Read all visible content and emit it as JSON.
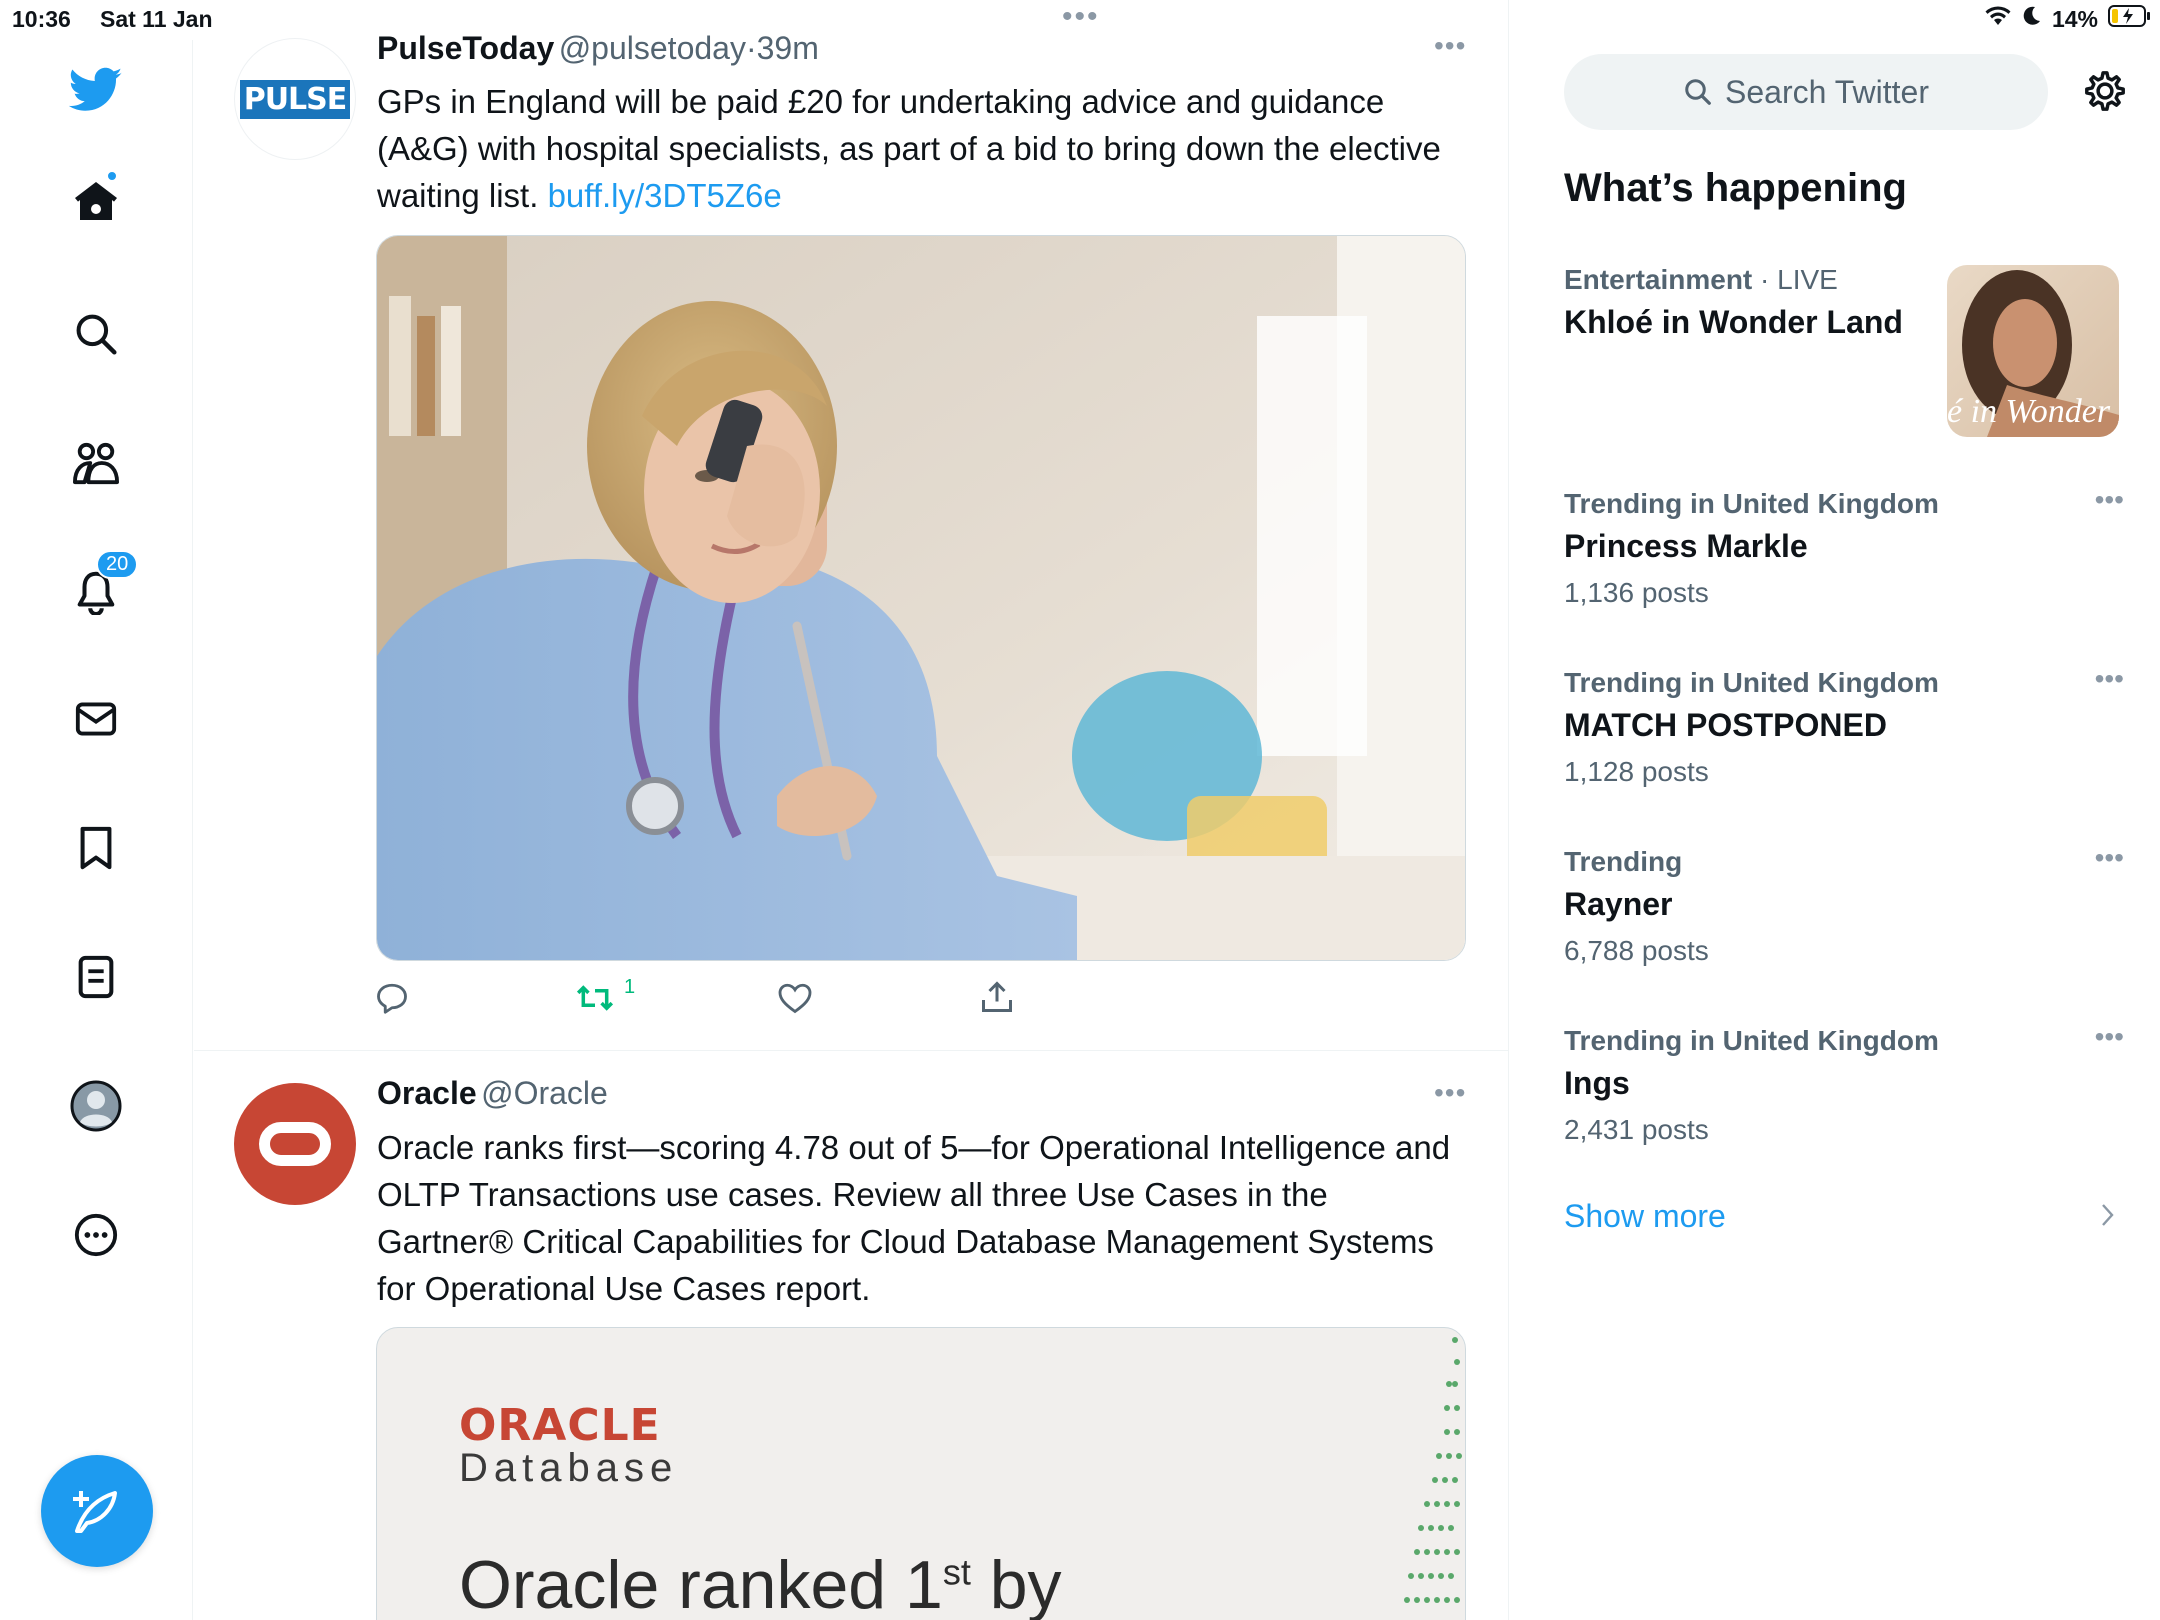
{
  "status_bar": {
    "time": "10:36",
    "date": "Sat 11 Jan",
    "battery": "14%",
    "center_dots": "•••"
  },
  "nav": {
    "notifications_badge": "20"
  },
  "tweets": [
    {
      "name": "PulseToday",
      "handle": "@pulsetoday",
      "sep": "·",
      "time": "39m",
      "avatar_text": "PULSE",
      "text": "GPs in England will be paid £20 for undertaking advice and guidance (A&G) with hospital specialists, as part of a bid to bring down the elective waiting list.",
      "link": "buff.ly/3DT5Z6e",
      "retweets": "1"
    },
    {
      "name": "Oracle",
      "handle": "@Oracle",
      "text": "Oracle ranks first—scoring 4.78 out of 5—for Operational Intelligence and OLTP Transactions use cases. Review all three Use Cases in the Gartner® Critical Capabilities for Cloud Database Management Systems for Operational Use Cases report.",
      "card_brand": "ORACLE",
      "card_product": "Database",
      "card_headline": "Oracle ranked 1",
      "card_sup": "st",
      "card_headline_end": " by"
    }
  ],
  "sidebar": {
    "search_placeholder": "Search Twitter",
    "title": "What’s happening",
    "featured": {
      "category": "Entertainment",
      "sep": " · ",
      "live": "LIVE",
      "name": "Khloé in Wonder Land",
      "image_text": "é in Wonder L"
    },
    "trends": [
      {
        "category": "Trending in United Kingdom",
        "name": "Princess Markle",
        "posts": "1,136 posts"
      },
      {
        "category": "Trending in United Kingdom",
        "name": "MATCH POSTPONED",
        "posts": "1,128 posts"
      },
      {
        "category": "Trending",
        "name": "Rayner",
        "posts": "6,788 posts"
      },
      {
        "category": "Trending in United Kingdom",
        "name": "Ings",
        "posts": "2,431 posts"
      }
    ],
    "show_more": "Show more"
  },
  "colors": {
    "accent": "#1d9bf0",
    "retweet": "#00ba7c",
    "oracle_red": "#c74634"
  }
}
